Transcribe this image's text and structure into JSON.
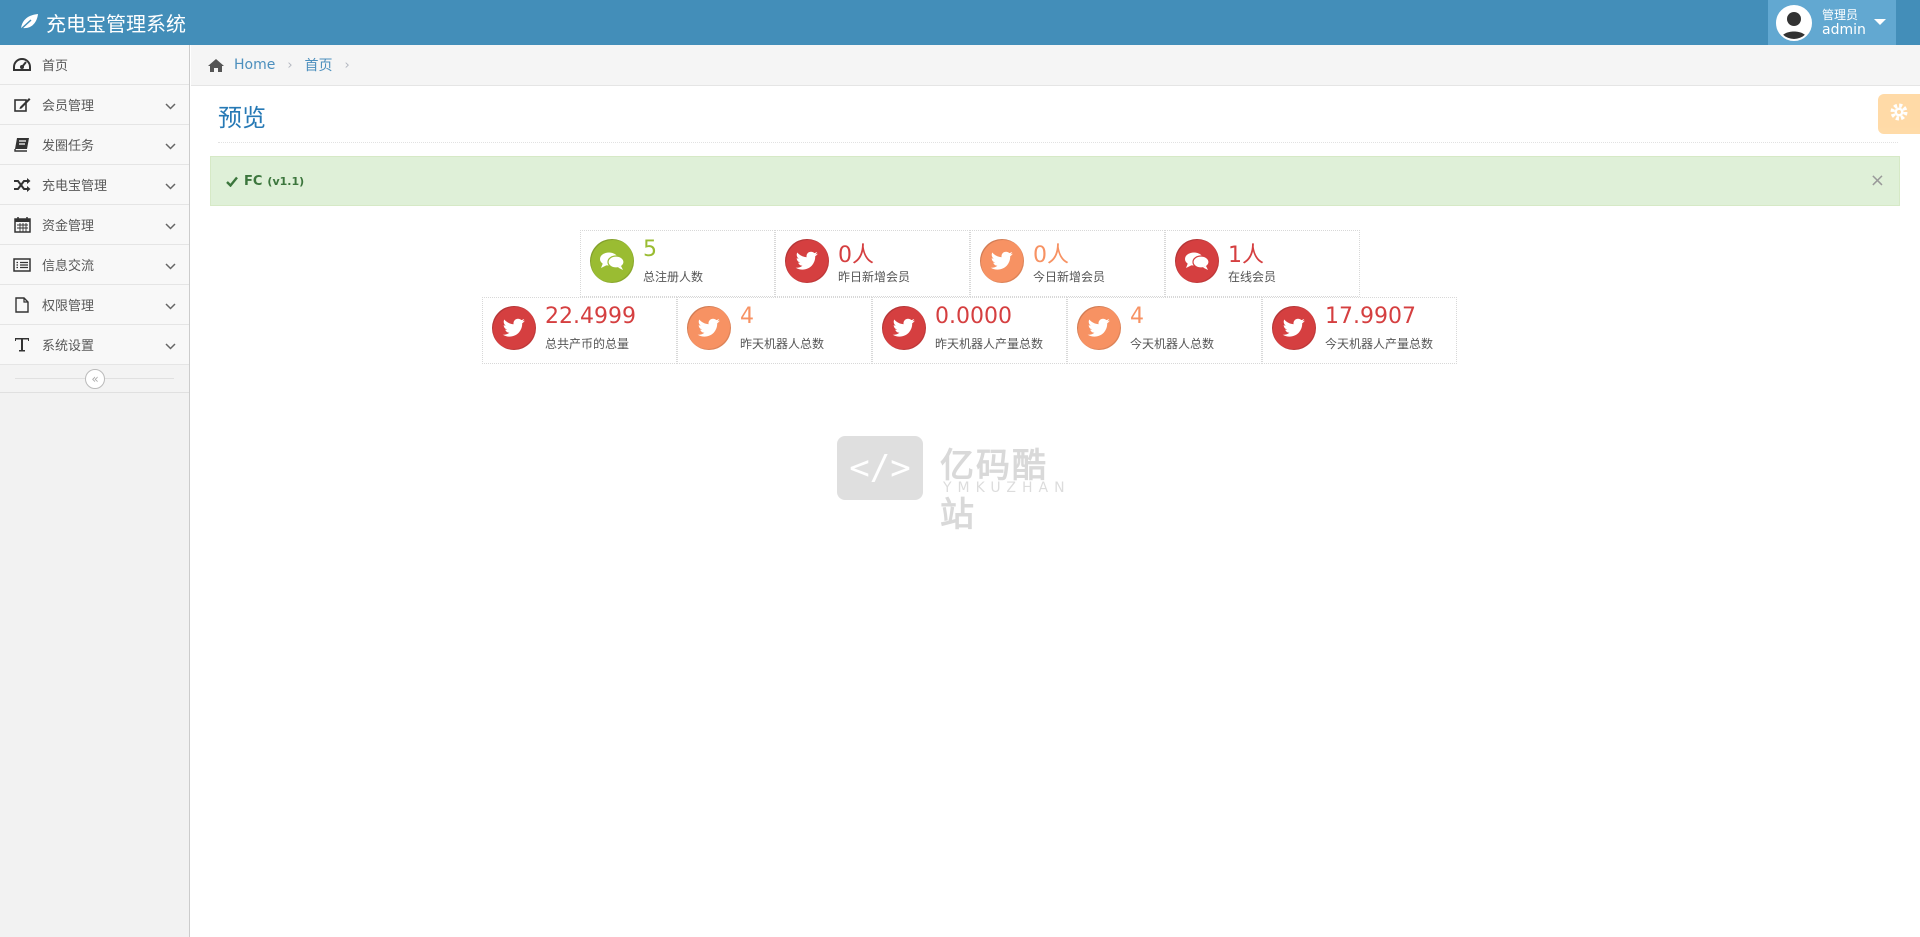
{
  "app": {
    "title": "充电宝管理系统"
  },
  "user": {
    "role": "管理员",
    "name": "admin"
  },
  "sidebar": {
    "items": [
      {
        "label": "首页",
        "icon": "dashboard-icon",
        "has_submenu": false
      },
      {
        "label": "会员管理",
        "icon": "edit-icon",
        "has_submenu": true
      },
      {
        "label": "发圈任务",
        "icon": "book-icon",
        "has_submenu": true
      },
      {
        "label": "充电宝管理",
        "icon": "shuffle-icon",
        "has_submenu": true
      },
      {
        "label": "资金管理",
        "icon": "calendar-icon",
        "has_submenu": true
      },
      {
        "label": "信息交流",
        "icon": "list-icon",
        "has_submenu": true
      },
      {
        "label": "权限管理",
        "icon": "file-icon",
        "has_submenu": true
      },
      {
        "label": "系统设置",
        "icon": "text-icon",
        "has_submenu": true
      }
    ],
    "collapse_glyph": "«"
  },
  "breadcrumb": {
    "home": "Home",
    "current": "首页",
    "separator": "›"
  },
  "page": {
    "title": "预览"
  },
  "alert": {
    "title": "FC",
    "version": "(v1.1)",
    "close": "×"
  },
  "stats_row1": [
    {
      "value": "5",
      "label": "总注册人数",
      "color": "green",
      "icon": "comments-icon"
    },
    {
      "value": "0人",
      "label": "昨日新增会员",
      "color": "red",
      "icon": "twitter-icon"
    },
    {
      "value": "0人",
      "label": "今日新增会员",
      "color": "orange",
      "icon": "twitter-icon"
    },
    {
      "value": "1人",
      "label": "在线会员",
      "color": "red",
      "icon": "comments-icon"
    }
  ],
  "stats_row2": [
    {
      "value": "22.4999",
      "label": "总共产币的总量",
      "color": "red",
      "icon": "twitter-icon"
    },
    {
      "value": "4",
      "label": "昨天机器人总数",
      "color": "orange",
      "icon": "twitter-icon"
    },
    {
      "value": "0.0000",
      "label": "昨天机器人产量总数",
      "color": "red",
      "icon": "twitter-icon"
    },
    {
      "value": "4",
      "label": "今天机器人总数",
      "color": "orange",
      "icon": "twitter-icon"
    },
    {
      "value": "17.9907",
      "label": "今天机器人产量总数",
      "color": "red",
      "icon": "twitter-icon"
    }
  ],
  "watermark": {
    "main": "亿码酷站",
    "sub": "YMKUZHAN",
    "glyph": "</>"
  },
  "colors": {
    "navbar": "#438eb9",
    "green": "#9abc32",
    "red": "#d53f40",
    "orange": "#f79263"
  }
}
